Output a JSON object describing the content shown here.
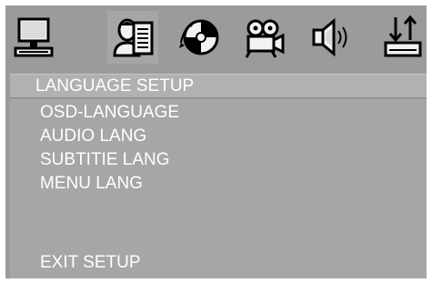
{
  "toolbar": {
    "items": [
      {
        "icon": "computer-icon",
        "selected": false
      },
      {
        "icon": "language-icon",
        "selected": true
      },
      {
        "icon": "disc-icon",
        "selected": false
      },
      {
        "icon": "video-camera-icon",
        "selected": false
      },
      {
        "icon": "speaker-icon",
        "selected": false
      },
      {
        "icon": "preferences-icon",
        "selected": false
      }
    ]
  },
  "menu": {
    "title": "LANGUAGE SETUP",
    "items": [
      {
        "label": "OSD-LANGUAGE"
      },
      {
        "label": "AUDIO  LANG"
      },
      {
        "label": "SUBTITIE  LANG"
      },
      {
        "label": "MENU LANG"
      }
    ],
    "exit_label": "EXIT SETUP"
  },
  "colors": {
    "background": "#9b9b9b",
    "content": "#a6a6a6",
    "title_bar": "#b1b1b1",
    "text": "#ffffff",
    "icon_dark": "#000000"
  }
}
